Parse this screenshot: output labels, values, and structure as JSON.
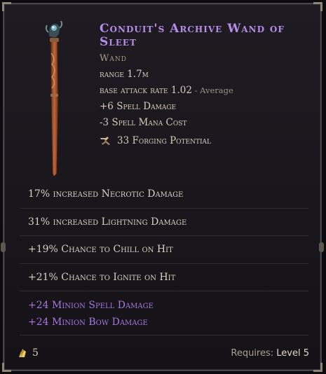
{
  "item": {
    "name": "Conduit's Archive Wand of Sleet",
    "type": "Wand",
    "colors": {
      "name": "#b78be8",
      "implicit": "#a977e2",
      "stat": "#d9cdbb"
    },
    "icon": "wand-icon"
  },
  "base_stats": [
    {
      "label": "range 1.7m"
    },
    {
      "label": "base attack rate 1.02",
      "sub": " - Average"
    },
    {
      "label": "+6 Spell Damage"
    },
    {
      "label": "-3 Spell Mana Cost"
    }
  ],
  "forging": {
    "icon": "hammer-icon",
    "label": "33 Forging Potential"
  },
  "affixes": [
    "17% increased Necrotic Damage",
    "31% increased Lightning Damage",
    "+19% Chance to Chill on Hit",
    "+21% Chance to Ignite on Hit"
  ],
  "implicits": [
    "+24 Minion Spell Damage",
    "+24 Minion Bow Damage"
  ],
  "footer": {
    "shard_icon": "shard-icon",
    "shard_count": "5",
    "requires_label": "Requires: ",
    "requires_level": "Level 5"
  }
}
